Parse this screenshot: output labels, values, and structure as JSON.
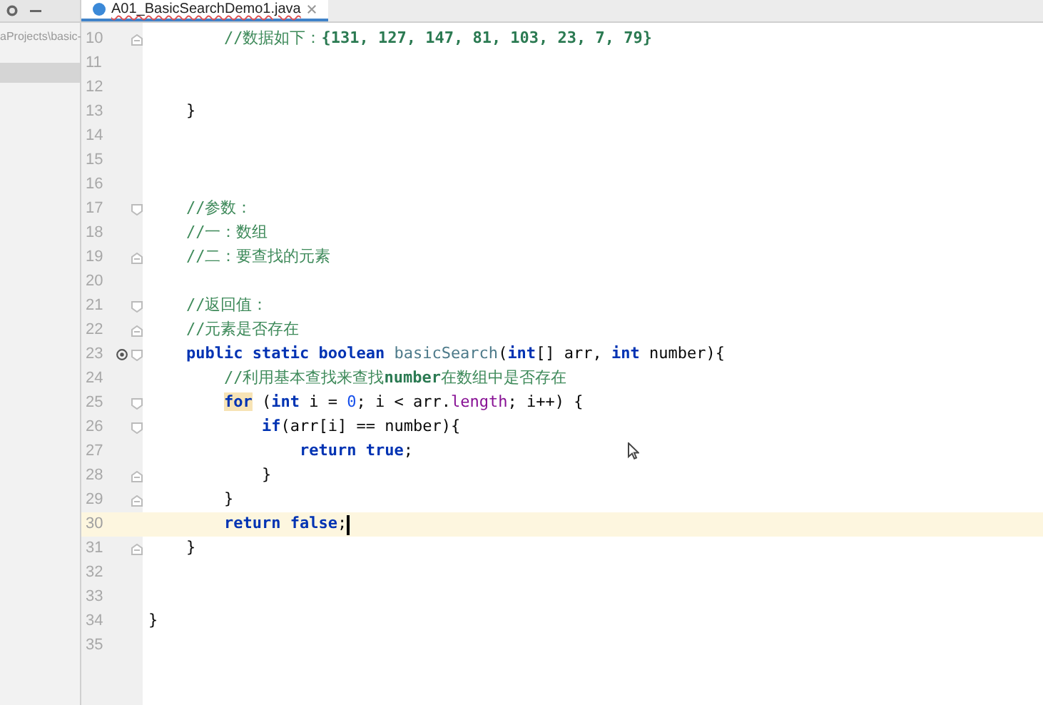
{
  "sidebar": {
    "path": "aProjects\\basic-",
    "rows": [
      {
        "selected": true
      }
    ]
  },
  "tab": {
    "label": "A01_BasicSearchDemo1.java",
    "selected": true
  },
  "lines": [
    {
      "number": "10",
      "fold_start": false,
      "fold_end": true,
      "override": false,
      "current": false,
      "tokens": [
        {
          "kind": "comment",
          "text": "        //数据如下："
        },
        {
          "kind": "comment_code",
          "text": "{131, 127, 147, 81, 103, 23, 7, 79}"
        }
      ]
    },
    {
      "number": "11",
      "fold_start": false,
      "fold_end": false,
      "override": false,
      "current": false
    },
    {
      "number": "12",
      "fold_start": false,
      "fold_end": false,
      "override": false,
      "current": false
    },
    {
      "number": "13",
      "fold_start": false,
      "fold_end": false,
      "override": false,
      "current": false,
      "tokens": [
        {
          "kind": "plain",
          "text": "    }"
        }
      ]
    },
    {
      "number": "14",
      "fold_start": false,
      "fold_end": false,
      "override": false,
      "current": false
    },
    {
      "number": "15",
      "fold_start": false,
      "fold_end": false,
      "override": false,
      "current": false
    },
    {
      "number": "16",
      "fold_start": false,
      "fold_end": false,
      "override": false,
      "current": false
    },
    {
      "number": "17",
      "fold_start": true,
      "fold_end": false,
      "override": false,
      "current": false,
      "tokens": [
        {
          "kind": "comment",
          "text": "    //参数："
        }
      ]
    },
    {
      "number": "18",
      "fold_start": false,
      "fold_end": false,
      "override": false,
      "current": false,
      "tokens": [
        {
          "kind": "comment",
          "text": "    //一：数组"
        }
      ]
    },
    {
      "number": "19",
      "fold_start": false,
      "fold_end": true,
      "override": false,
      "current": false,
      "tokens": [
        {
          "kind": "comment",
          "text": "    //二：要查找的元素"
        }
      ]
    },
    {
      "number": "20",
      "fold_start": false,
      "fold_end": false,
      "override": false,
      "current": false
    },
    {
      "number": "21",
      "fold_start": true,
      "fold_end": false,
      "override": false,
      "current": false,
      "tokens": [
        {
          "kind": "comment",
          "text": "    //返回值："
        }
      ]
    },
    {
      "number": "22",
      "fold_start": false,
      "fold_end": true,
      "override": false,
      "current": false,
      "tokens": [
        {
          "kind": "comment",
          "text": "    //元素是否存在"
        }
      ]
    },
    {
      "number": "23",
      "fold_start": true,
      "fold_end": false,
      "override": true,
      "current": false,
      "tokens": [
        {
          "kind": "keyword",
          "text": "    public static boolean"
        },
        {
          "kind": "method",
          "text": " basicSearch"
        },
        {
          "kind": "plain",
          "text": "("
        },
        {
          "kind": "keyword",
          "text": "int"
        },
        {
          "kind": "plain",
          "text": "[] arr, "
        },
        {
          "kind": "keyword",
          "text": "int"
        },
        {
          "kind": "plain",
          "text": " number){"
        }
      ]
    },
    {
      "number": "24",
      "fold_start": false,
      "fold_end": false,
      "override": false,
      "current": false,
      "tokens": [
        {
          "kind": "comment",
          "text": "        //利用基本查找来查找"
        },
        {
          "kind": "comment_code",
          "text": "number"
        },
        {
          "kind": "comment",
          "text": "在数组中是否存在"
        }
      ]
    },
    {
      "number": "25",
      "fold_start": true,
      "fold_end": false,
      "override": false,
      "current": false,
      "tokens": [
        {
          "kind": "keyword_match",
          "text": "        for"
        },
        {
          "kind": "plain",
          "text": " ("
        },
        {
          "kind": "keyword",
          "text": "int"
        },
        {
          "kind": "plain",
          "text": " i = "
        },
        {
          "kind": "number",
          "text": "0"
        },
        {
          "kind": "plain",
          "text": "; i < arr."
        },
        {
          "kind": "field",
          "text": "length"
        },
        {
          "kind": "plain",
          "text": "; i++) {"
        }
      ]
    },
    {
      "number": "26",
      "fold_start": true,
      "fold_end": false,
      "override": false,
      "current": false,
      "tokens": [
        {
          "kind": "keyword",
          "text": "            if"
        },
        {
          "kind": "plain",
          "text": "(arr[i] == number){"
        }
      ]
    },
    {
      "number": "27",
      "fold_start": false,
      "fold_end": false,
      "override": false,
      "current": false,
      "tokens": [
        {
          "kind": "keyword",
          "text": "                return true"
        },
        {
          "kind": "plain",
          "text": ";"
        }
      ]
    },
    {
      "number": "28",
      "fold_start": false,
      "fold_end": true,
      "override": false,
      "current": false,
      "tokens": [
        {
          "kind": "plain",
          "text": "            }"
        }
      ]
    },
    {
      "number": "29",
      "fold_start": false,
      "fold_end": true,
      "override": false,
      "current": false,
      "tokens": [
        {
          "kind": "plain",
          "text": "        }"
        }
      ]
    },
    {
      "number": "30",
      "fold_start": false,
      "fold_end": false,
      "override": false,
      "current": true,
      "tokens": [
        {
          "kind": "keyword",
          "text": "        return false"
        },
        {
          "kind": "plain",
          "text": ";"
        }
      ]
    },
    {
      "number": "31",
      "fold_start": false,
      "fold_end": true,
      "override": false,
      "current": false,
      "tokens": [
        {
          "kind": "plain",
          "text": "    }"
        }
      ]
    },
    {
      "number": "32",
      "fold_start": false,
      "fold_end": false,
      "override": false,
      "current": false
    },
    {
      "number": "33",
      "fold_start": false,
      "fold_end": false,
      "override": false,
      "current": false
    },
    {
      "number": "34",
      "fold_start": false,
      "fold_end": false,
      "override": false,
      "current": false,
      "tokens": [
        {
          "kind": "plain",
          "text": "}"
        }
      ]
    },
    {
      "number": "35",
      "fold_start": false,
      "fold_end": false,
      "override": false,
      "current": false
    }
  ]
}
